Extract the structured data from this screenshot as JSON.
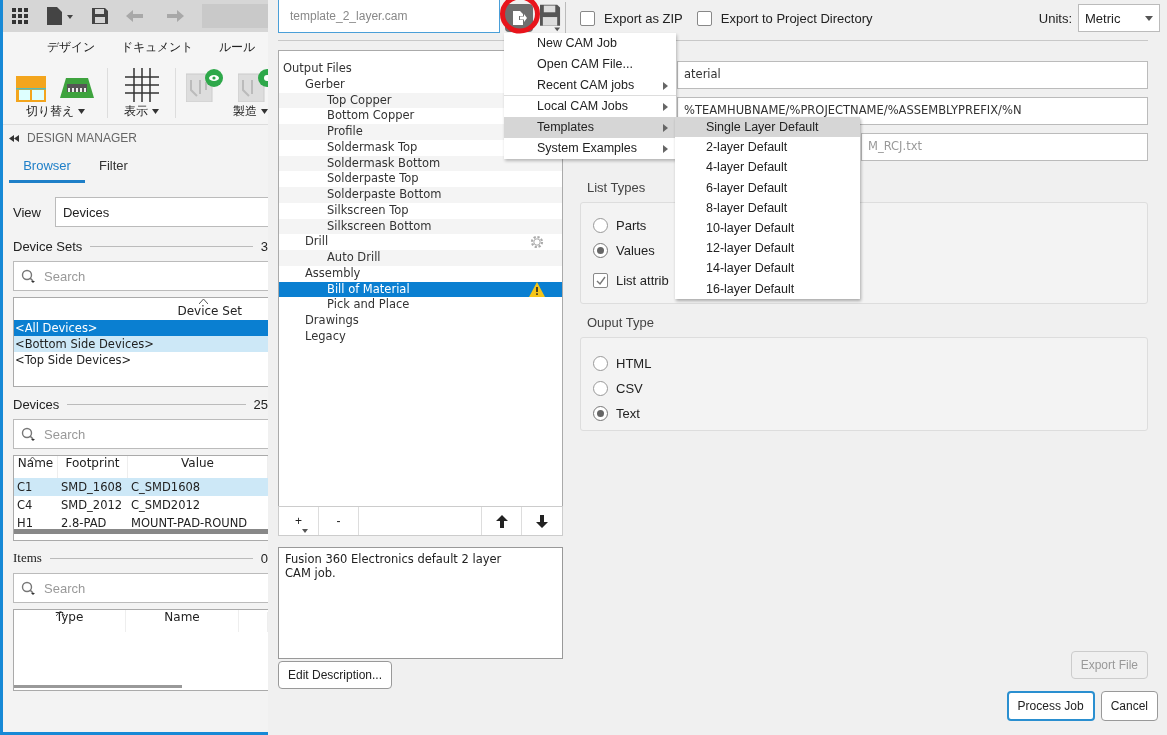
{
  "left_panel": {
    "ribbon_tabs": [
      "デザイン",
      "ドキュメント",
      "ルール"
    ],
    "ribbon_groups": [
      {
        "label": "切り替え",
        "dropdown": true
      },
      {
        "label": "表示",
        "dropdown": true
      },
      {
        "label": "製造",
        "dropdown": true
      }
    ],
    "panel_title": "DESIGN MANAGER",
    "tabs": [
      {
        "label": "Browser",
        "selected": true
      },
      {
        "label": "Filter",
        "selected": false
      }
    ],
    "view": {
      "label": "View",
      "value": "Devices"
    },
    "device_sets": {
      "title": "Device Sets",
      "count": "3",
      "search_placeholder": "Search",
      "column": "Device Set",
      "rows": [
        {
          "name": "<All Devices>",
          "selected": true,
          "highlighted": false
        },
        {
          "name": "<Bottom Side Devices>",
          "selected": false,
          "highlighted": true
        },
        {
          "name": "<Top Side Devices>",
          "selected": false,
          "highlighted": false
        }
      ]
    },
    "devices": {
      "title": "Devices",
      "count": "25",
      "search_placeholder": "Search",
      "columns": [
        "Name",
        "Footprint",
        "Value"
      ],
      "rows": [
        {
          "cells": [
            "C1",
            "SMD_1608",
            "C_SMD1608"
          ],
          "highlighted": true
        },
        {
          "cells": [
            "C4",
            "SMD_2012",
            "C_SMD2012"
          ],
          "highlighted": false
        },
        {
          "cells": [
            "H1",
            "2.8-PAD",
            "MOUNT-PAD-ROUND"
          ],
          "highlighted": false
        }
      ]
    },
    "items": {
      "title": "Items",
      "count": "0",
      "search_placeholder": "Search",
      "columns": [
        "Type",
        "Name"
      ]
    }
  },
  "cam": {
    "filename": "template_2_layer.cam",
    "export_zip": {
      "label": "Export as ZIP",
      "checked": false
    },
    "export_project": {
      "label": "Export to Project Directory",
      "checked": false
    },
    "units": {
      "label": "Units:",
      "value": "Metric",
      "dropdown": true
    },
    "output_tree": [
      {
        "label": "Output Files",
        "selected": false,
        "children": [
          {
            "label": "Gerber",
            "selected": false,
            "children": [
              {
                "label": "Top Copper",
                "selected": false,
                "kind": "plain"
              },
              {
                "label": "Bottom Copper",
                "selected": false,
                "kind": "plain"
              },
              {
                "label": "Profile",
                "selected": false,
                "kind": "plain"
              },
              {
                "label": "Soldermask Top",
                "selected": false,
                "kind": "plain"
              },
              {
                "label": "Soldermask Bottom",
                "selected": false,
                "kind": "plain"
              },
              {
                "label": "Solderpaste Top",
                "selected": false,
                "kind": "plain"
              },
              {
                "label": "Solderpaste Bottom",
                "selected": false,
                "kind": "plain"
              },
              {
                "label": "Silkscreen Top",
                "selected": false,
                "kind": "plain"
              },
              {
                "label": "Silkscreen Bottom",
                "selected": false,
                "kind": "plain"
              }
            ]
          },
          {
            "label": "Drill",
            "selected": false,
            "kind": "settings",
            "children": [
              {
                "label": "Auto Drill",
                "selected": false,
                "kind": "plain"
              }
            ]
          },
          {
            "label": "Assembly",
            "selected": false,
            "children": [
              {
                "label": "Bill of Material",
                "selected": true,
                "kind": "warning"
              },
              {
                "label": "Pick and Place",
                "selected": false,
                "kind": "plain"
              }
            ]
          },
          {
            "label": "Drawings",
            "selected": false
          },
          {
            "label": "Legacy",
            "selected": false
          }
        ]
      }
    ],
    "list_buttons": [
      {
        "label": "+",
        "dropdown": true
      },
      {
        "label": "-",
        "dropdown": false
      }
    ],
    "description": "Fusion 360 Electronics default 2 layer CAM job.",
    "edit_description": "Edit Description...",
    "fields": [
      {
        "value": "aterial"
      },
      {
        "value": "%TEAMHUBNAME/%PROJECTNAME/%ASSEMBLYPREFIX/%N"
      },
      {
        "placeholder": "M_RCJ.txt"
      }
    ],
    "list_types": {
      "title": "List Types",
      "options": [
        {
          "label": "Parts",
          "selected": false
        },
        {
          "label": "Values",
          "selected": true
        }
      ],
      "checkbox": {
        "label": "List attrib",
        "checked": true
      }
    },
    "output_type": {
      "title": "Ouput Type",
      "options": [
        {
          "label": "HTML",
          "selected": false
        },
        {
          "label": "CSV",
          "selected": false
        },
        {
          "label": "Text",
          "selected": true
        }
      ]
    },
    "export_file": {
      "label": "Export File",
      "disabled": true
    },
    "process_job": {
      "label": "Process Job",
      "default": true
    },
    "cancel": {
      "label": "Cancel",
      "default": false
    }
  },
  "file_menu": {
    "items": [
      {
        "label": "New CAM Job",
        "submenu": false,
        "highlighted": false,
        "separator_after": false
      },
      {
        "label": "Open CAM File...",
        "submenu": false,
        "highlighted": false,
        "separator_after": false
      },
      {
        "label": "Recent CAM jobs",
        "submenu": true,
        "highlighted": false,
        "separator_after": true
      },
      {
        "label": "Local CAM Jobs",
        "submenu": true,
        "highlighted": false,
        "separator_after": false
      },
      {
        "label": "Templates",
        "submenu": true,
        "highlighted": true,
        "separator_after": false
      },
      {
        "label": "System Examples",
        "submenu": true,
        "highlighted": false,
        "separator_after": false
      }
    ]
  },
  "templates_submenu": {
    "items": [
      {
        "label": "Single Layer Default",
        "highlighted": true
      },
      {
        "label": "2-layer Default",
        "highlighted": false
      },
      {
        "label": "4-layer Default",
        "highlighted": false
      },
      {
        "label": "6-layer Default",
        "highlighted": false
      },
      {
        "label": "8-layer Default",
        "highlighted": false
      },
      {
        "label": "10-layer Default",
        "highlighted": false
      },
      {
        "label": "12-layer Default",
        "highlighted": false
      },
      {
        "label": "14-layer Default",
        "highlighted": false
      },
      {
        "label": "16-layer Default",
        "highlighted": false
      }
    ]
  },
  "annotation": {
    "kind": "circle"
  }
}
